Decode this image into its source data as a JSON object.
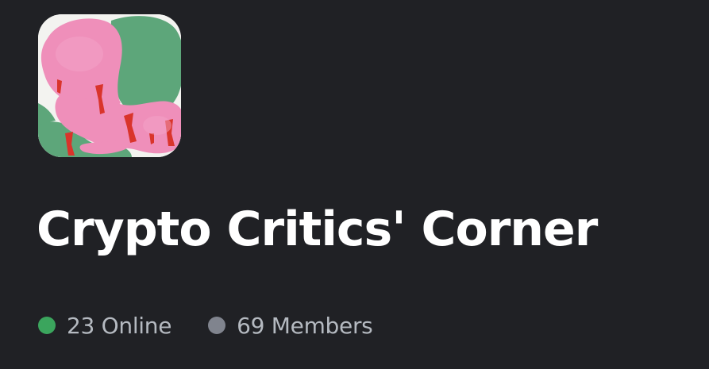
{
  "server": {
    "name": "Crypto Critics' Corner",
    "icon": "server-icon-artwork"
  },
  "stats": {
    "online": {
      "label": "23 Online",
      "color": "#3ba55d"
    },
    "members": {
      "label": "69 Members",
      "color": "#80848e"
    }
  }
}
